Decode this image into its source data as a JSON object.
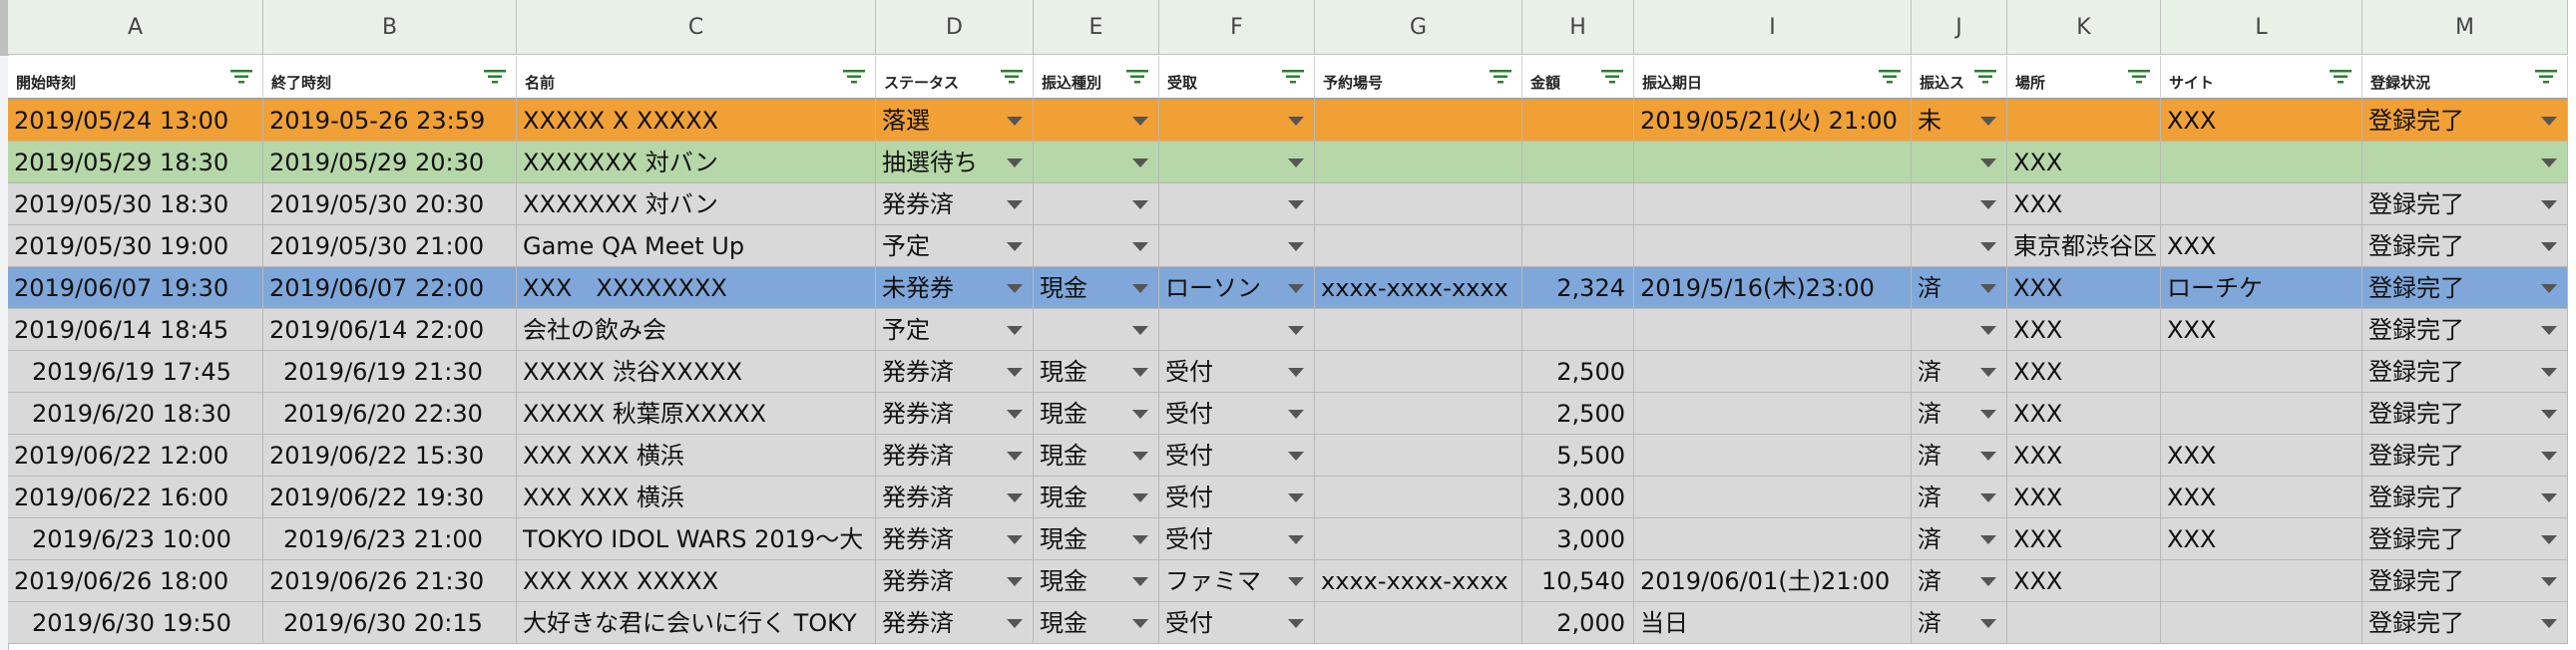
{
  "columns": [
    "A",
    "B",
    "C",
    "D",
    "E",
    "F",
    "G",
    "H",
    "I",
    "J",
    "K",
    "L",
    "M"
  ],
  "headers": [
    "開始時刻",
    "終了時刻",
    "名前",
    "ステータス",
    "振込種別",
    "受取",
    "予約場号",
    "金額",
    "振込期日",
    "振込ス",
    "場所",
    "サイト",
    "登録状況"
  ],
  "rows": [
    {
      "color": "orange",
      "cells": [
        "2019/05/24 13:00",
        "2019-05-26 23:59",
        "XXXXX X XXXXX",
        "落選",
        "",
        "",
        "",
        "",
        "2019/05/21(火) 21:00",
        "未",
        "",
        "XXX",
        "登録完了"
      ]
    },
    {
      "color": "green",
      "cells": [
        "2019/05/29 18:30",
        "2019/05/29 20:30",
        "XXXXXXX 対バン",
        "抽選待ち",
        "",
        "",
        "",
        "",
        "",
        "",
        "XXX",
        "",
        ""
      ]
    },
    {
      "color": "grey",
      "cells": [
        "2019/05/30 18:30",
        "2019/05/30 20:30",
        "XXXXXXX 対バン",
        "発券済",
        "",
        "",
        "",
        "",
        "",
        "",
        "XXX",
        "",
        "登録完了"
      ]
    },
    {
      "color": "grey",
      "cells": [
        "2019/05/30 19:00",
        "2019/05/30 21:00",
        "Game QA Meet Up",
        "予定",
        "",
        "",
        "",
        "",
        "",
        "",
        "東京都渋谷区",
        "XXX",
        "登録完了"
      ]
    },
    {
      "color": "blue",
      "cells": [
        "2019/06/07 19:30",
        "2019/06/07 22:00",
        "XXX　XXXXXXXX",
        "未発券",
        "現金",
        "ローソン",
        "xxxx-xxxx-xxxx",
        "2,324",
        "2019/5/16(木)23:00",
        "済",
        "XXX",
        "ローチケ",
        "登録完了"
      ]
    },
    {
      "color": "grey",
      "cells": [
        "2019/06/14 18:45",
        "2019/06/14 22:00",
        "会社の飲み会",
        "予定",
        "",
        "",
        "",
        "",
        "",
        "",
        "XXX",
        "XXX",
        "登録完了"
      ]
    },
    {
      "color": "grey",
      "cells": [
        "2019/6/19 17:45",
        "2019/6/19 21:30",
        "XXXXX 渋谷XXXXX",
        "発券済",
        "現金",
        "受付",
        "",
        "2,500",
        "",
        "済",
        "XXX",
        "",
        "登録完了"
      ]
    },
    {
      "color": "grey",
      "cells": [
        "2019/6/20 18:30",
        "2019/6/20 22:30",
        "XXXXX 秋葉原XXXXX",
        "発券済",
        "現金",
        "受付",
        "",
        "2,500",
        "",
        "済",
        "XXX",
        "",
        "登録完了"
      ]
    },
    {
      "color": "grey",
      "cells": [
        "2019/06/22 12:00",
        "2019/06/22 15:30",
        "XXX XXX 横浜",
        "発券済",
        "現金",
        "受付",
        "",
        "5,500",
        "",
        "済",
        "XXX",
        "XXX",
        "登録完了"
      ]
    },
    {
      "color": "grey",
      "cells": [
        "2019/06/22 16:00",
        "2019/06/22 19:30",
        "XXX XXX 横浜",
        "発券済",
        "現金",
        "受付",
        "",
        "3,000",
        "",
        "済",
        "XXX",
        "XXX",
        "登録完了"
      ]
    },
    {
      "color": "grey",
      "cells": [
        "2019/6/23 10:00",
        "2019/6/23 21:00",
        "TOKYO IDOL WARS 2019〜大",
        "発券済",
        "現金",
        "受付",
        "",
        "3,000",
        "",
        "済",
        "XXX",
        "XXX",
        "登録完了"
      ]
    },
    {
      "color": "grey",
      "cells": [
        "2019/06/26 18:00",
        "2019/06/26 21:30",
        "XXX XXX XXXXX",
        "発券済",
        "現金",
        "ファミマ",
        "xxxx-xxxx-xxxx",
        "10,540",
        "2019/06/01(土)21:00",
        "済",
        "XXX",
        "",
        "登録完了"
      ]
    },
    {
      "color": "grey",
      "cells": [
        "2019/6/30 19:50",
        "2019/6/30 20:15",
        "大好きな君に会いに行く TOKY",
        "発券済",
        "現金",
        "受付",
        "",
        "2,000",
        "当日",
        "済",
        "",
        "",
        "登録完了"
      ]
    }
  ]
}
